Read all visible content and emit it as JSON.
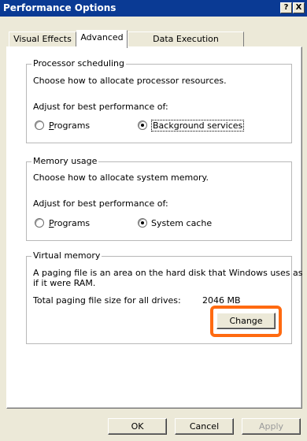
{
  "window": {
    "title": "Performance Options",
    "help_button": "?",
    "close_button": "X"
  },
  "tabs": [
    {
      "label": "Visual Effects",
      "selected": false
    },
    {
      "label": "Advanced",
      "selected": true
    },
    {
      "label": "Data Execution Prevention",
      "selected": false
    }
  ],
  "processor_scheduling": {
    "legend": "Processor scheduling",
    "description": "Choose how to allocate processor resources.",
    "adjust_label": "Adjust for best performance of:",
    "options": [
      {
        "label": "Programs",
        "checked": false
      },
      {
        "label": "Background services",
        "checked": true
      }
    ]
  },
  "memory_usage": {
    "legend": "Memory usage",
    "description": "Choose how to allocate system memory.",
    "adjust_label": "Adjust for best performance of:",
    "options": [
      {
        "label": "Programs",
        "checked": false
      },
      {
        "label": "System cache",
        "checked": true
      }
    ]
  },
  "virtual_memory": {
    "legend": "Virtual memory",
    "description_line1": "A paging file is an area on the hard disk that Windows uses as",
    "description_line2": "if it were RAM.",
    "total_label": "Total paging file size for all drives:",
    "total_value": "2046 MB",
    "change_button": "Change"
  },
  "footer": {
    "ok": "OK",
    "cancel": "Cancel",
    "apply": "Apply"
  },
  "colors": {
    "titlebar": "#0a3a94",
    "highlight": "#ff6a10"
  }
}
